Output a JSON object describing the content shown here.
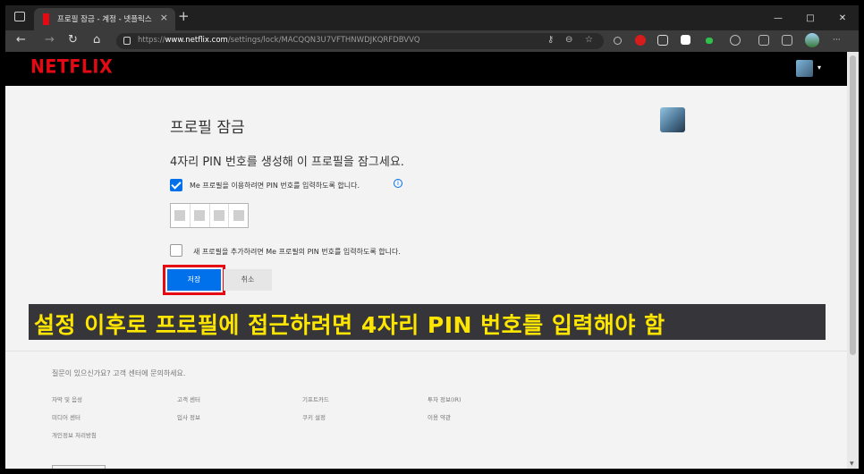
{
  "browser": {
    "tab_title": "프로필 잠금 - 계정 - 넷플릭스",
    "tab_close": "×",
    "new_tab": "+",
    "url_prefix": "https://",
    "url_host": "www.netflix.com",
    "url_path": "/settings/lock/MACQQN3U7VFTHNWDJKQRFDBVVQ",
    "minimize": "—",
    "maximize": "□",
    "close": "✕",
    "more": "···",
    "back": "←",
    "forward": "→",
    "refresh": "↻",
    "home": "⌂"
  },
  "header": {
    "logo": "NETFLIX",
    "caret": "▾"
  },
  "main": {
    "title": "프로필 잠금",
    "subtitle": "4자리 PIN 번호를 생성해 이 프로필을 잠그세요.",
    "require_pin_label": "Me 프로필을 이용하려면 PIN 번호를 입력하도록 합니다.",
    "require_pin_checked": true,
    "info_icon": "i",
    "pin_digits": [
      "",
      "",
      "",
      ""
    ],
    "require_add_profile_label": "새 프로필을 추가하려면 Me 프로필의 PIN 번호를 입력하도록 합니다.",
    "require_add_profile_checked": false,
    "save_label": "저장",
    "cancel_label": "취소"
  },
  "caption": "설정 이후로 프로필에 접근하려면 4자리 PIN 번호를 입력해야 함",
  "footer": {
    "question": "질문이 있으신가요? 고객 센터에 문의하세요.",
    "links": [
      "자막 및 음성",
      "고객 센터",
      "기프트카드",
      "투자 정보(IR)",
      "미디어 센터",
      "입사 정보",
      "쿠키 설정",
      "이용 약관",
      "개인정보 처리방침"
    ]
  },
  "colors": {
    "netflix_red": "#e50914",
    "primary_blue": "#0071eb",
    "caption_yellow": "#ffe600"
  }
}
